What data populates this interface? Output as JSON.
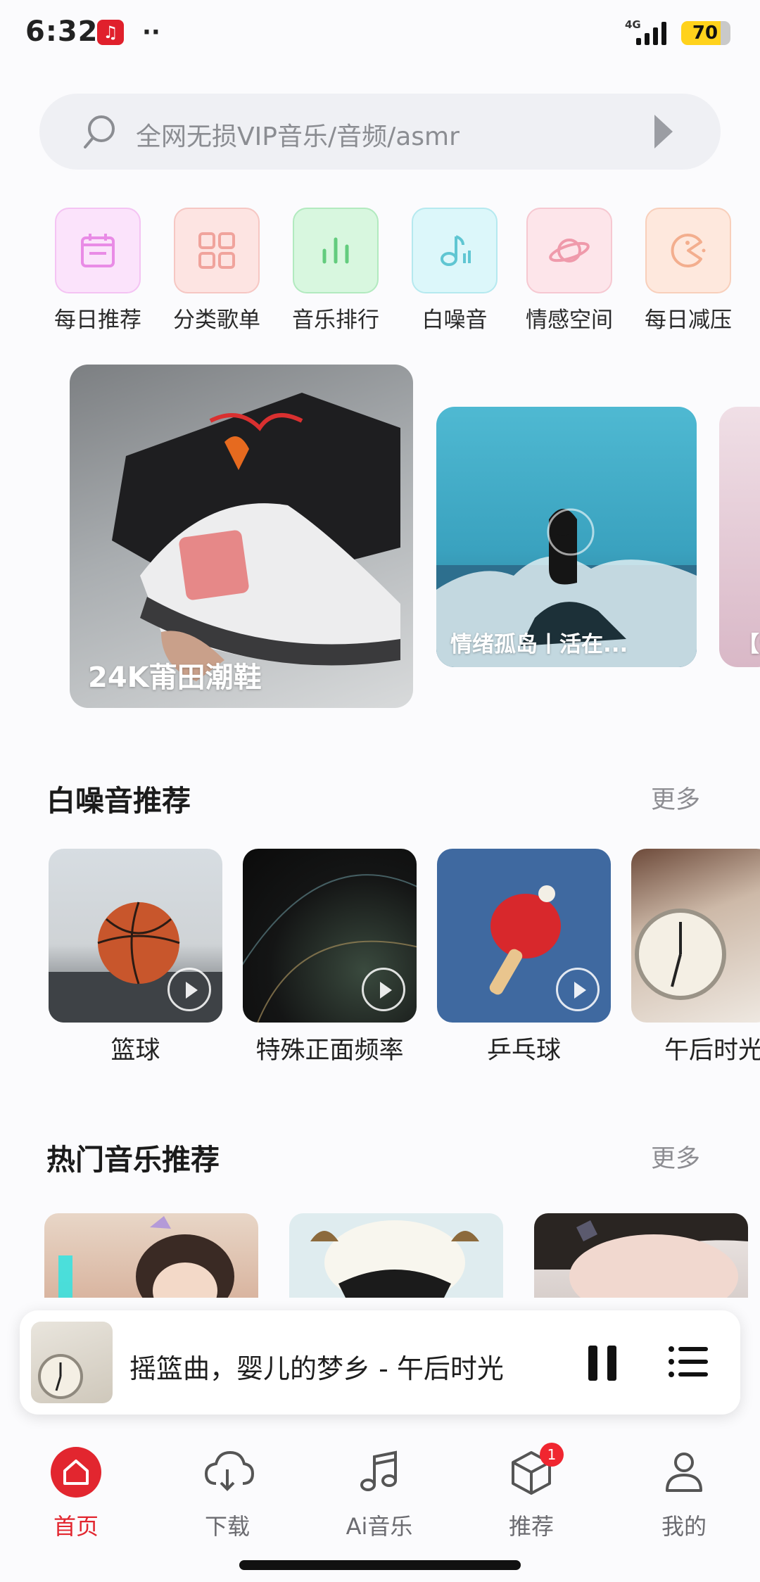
{
  "status": {
    "time": "6:32",
    "network": "4G",
    "battery": "70"
  },
  "search": {
    "placeholder": "全网无损VIP音乐/音频/asmr"
  },
  "categories": [
    {
      "label": "每日推荐",
      "icon": "calendar-icon"
    },
    {
      "label": "分类歌单",
      "icon": "grid-icon"
    },
    {
      "label": "音乐排行",
      "icon": "chart-bars-icon"
    },
    {
      "label": "白噪音",
      "icon": "music-note-icon"
    },
    {
      "label": "情感空间",
      "icon": "planet-icon"
    },
    {
      "label": "每日减压",
      "icon": "pacman-icon"
    }
  ],
  "banners": [
    {
      "title": "24K莆田潮鞋"
    },
    {
      "title": "情绪孤岛丨活在..."
    },
    {
      "title": "【爱"
    }
  ],
  "white_noise": {
    "title": "白噪音推荐",
    "more": "更多",
    "items": [
      {
        "label": "篮球"
      },
      {
        "label": "特殊正面频率"
      },
      {
        "label": "乒乓球"
      },
      {
        "label": "午后时光"
      }
    ]
  },
  "hot_music": {
    "title": "热门音乐推荐",
    "more": "更多"
  },
  "player": {
    "title": "摇篮曲，婴儿的梦乡 - 午后时光"
  },
  "nav": [
    {
      "label": "首页",
      "icon": "home-icon",
      "active": true
    },
    {
      "label": "下载",
      "icon": "cloud-download-icon"
    },
    {
      "label": "Ai音乐",
      "icon": "music-note-icon"
    },
    {
      "label": "推荐",
      "icon": "box-icon",
      "badge": "1"
    },
    {
      "label": "我的",
      "icon": "user-icon"
    }
  ],
  "colors": {
    "accent": "#e2262f",
    "badge": "#f02630",
    "battery": "#ffd21c"
  }
}
